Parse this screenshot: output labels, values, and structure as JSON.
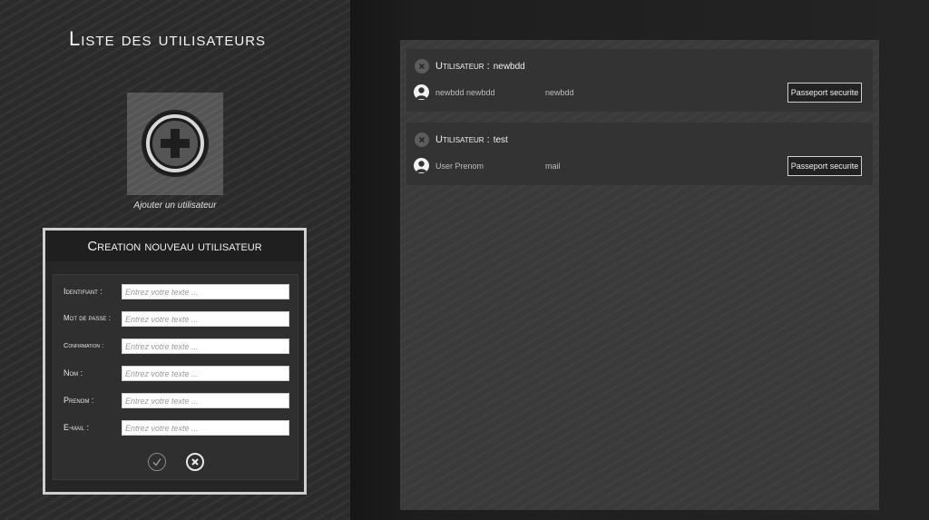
{
  "left": {
    "title": "Liste des utilisateurs",
    "add_label": "Ajouter un utilisateur"
  },
  "form": {
    "header": "Creation nouveau utilisateur",
    "fields": [
      {
        "label": "Identifiant :",
        "placeholder": "Entrez votre texte ...",
        "value": ""
      },
      {
        "label": "Mot de passe :",
        "placeholder": "Entrez votre texte ...",
        "value": ""
      },
      {
        "label": "Confirmation :",
        "placeholder": "Entrez votre texte ...",
        "value": ""
      },
      {
        "label": "Nom :",
        "placeholder": "Entrez votre texte ...",
        "value": ""
      },
      {
        "label": "Prenom :",
        "placeholder": "Entrez votre texte ...",
        "value": ""
      },
      {
        "label": "E-mail :",
        "placeholder": "Entrez votre texte ...",
        "value": ""
      }
    ],
    "confirm_icon": "check-icon",
    "cancel_icon": "close-icon"
  },
  "users": [
    {
      "header_label": "Utilisateur :",
      "username": "newbdd",
      "fullname": "newbdd newbdd",
      "email": "newbdd",
      "button_label": "Passeport securite"
    },
    {
      "header_label": "Utilisateur :",
      "username": "test",
      "fullname": "User Prenom",
      "email": "mail",
      "button_label": "Passeport securite"
    }
  ],
  "colors": {
    "background": "#262626",
    "panel": "#3a3a3a",
    "card": "#333333",
    "form_border": "#cfcfcf"
  }
}
